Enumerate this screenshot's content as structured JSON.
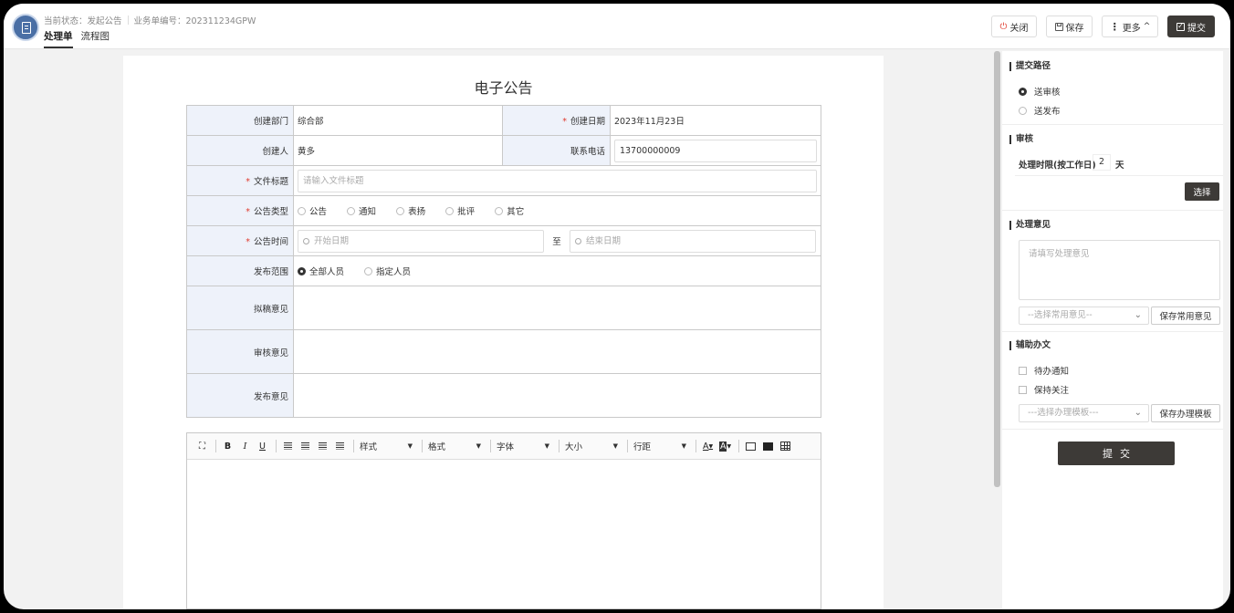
{
  "header": {
    "status_label": "当前状态：发起公告",
    "business_no_label": "业务单编号：202311234GPW",
    "tabs": [
      {
        "label": "处理单"
      },
      {
        "label": "流程图"
      }
    ],
    "buttons": {
      "close": "关闭",
      "save": "保存",
      "more": "更多",
      "submit": "提交"
    }
  },
  "document": {
    "title": "电子公告",
    "fields": {
      "dept_label": "创建部门",
      "dept_value": "综合部",
      "date_label": "创建日期",
      "date_value": "2023年11月23日",
      "creator_label": "创建人",
      "creator_value": "黄多",
      "phone_label": "联系电话",
      "phone_value": "13700000009",
      "subject_label": "文件标题",
      "subject_placeholder": "请输入文件标题",
      "type_label": "公告类型",
      "type_options": [
        "公告",
        "通知",
        "表扬",
        "批评",
        "其它"
      ],
      "time_label": "公告时间",
      "start_placeholder": "开始日期",
      "to_label": "至",
      "end_placeholder": "结束日期",
      "scope_label": "发布范围",
      "scope_options": [
        "全部人员",
        "指定人员"
      ],
      "scope_selected": "全部人员",
      "draft_opinion_label": "拟稿意见",
      "review_opinion_label": "审核意见",
      "publish_opinion_label": "发布意见",
      "required_mark": "*"
    },
    "editor": {
      "style": "样式",
      "format": "格式",
      "font": "字体",
      "size": "大小",
      "line_height": "行距",
      "bold": "B",
      "italic": "I",
      "underline": "U",
      "font_color": "A",
      "bg_color": "A"
    }
  },
  "panel": {
    "route_title": "提交路径",
    "route_options": [
      "送审核",
      "送发布"
    ],
    "route_selected": "送审核",
    "review_title": "审核",
    "deadline_label": "处理时限(按工作日)",
    "deadline_value": "2",
    "deadline_unit": "天",
    "choose_button": "选择",
    "opinion_title": "处理意见",
    "opinion_placeholder": "请填写处理意见",
    "common_opinion_select": "--选择常用意见--",
    "save_common_opinion": "保存常用意见",
    "assist_title": "辅助办文",
    "assist_options": [
      "待办通知",
      "保持关注"
    ],
    "template_select": "---选择办理模板---",
    "save_template": "保存办理模板",
    "submit_label": "提交"
  }
}
